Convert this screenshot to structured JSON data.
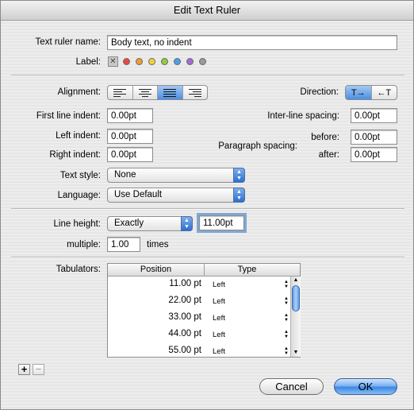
{
  "window": {
    "title": "Edit Text Ruler"
  },
  "ruler_name": {
    "label": "Text ruler name:",
    "value": "Body text, no indent"
  },
  "label_row": {
    "label": "Label:",
    "colors": [
      "#e8493f",
      "#f39a2a",
      "#f0d23a",
      "#8ccf3b",
      "#4f9de6",
      "#a56ad6",
      "#9a9a9a"
    ]
  },
  "alignment": {
    "label": "Alignment:",
    "options": [
      "left",
      "center",
      "justify",
      "right"
    ],
    "selected": "justify"
  },
  "direction": {
    "label": "Direction:",
    "options": [
      "T→",
      "←T"
    ],
    "selected": "T→"
  },
  "indents": {
    "first_line_label": "First line indent:",
    "first_line_value": "0.00pt",
    "left_label": "Left indent:",
    "left_value": "0.00pt",
    "right_label": "Right indent:",
    "right_value": "0.00pt"
  },
  "spacing": {
    "inter_line_label": "Inter-line spacing:",
    "inter_line_value": "0.00pt",
    "paragraph_label": "Paragraph spacing:",
    "before_label": "before:",
    "before_value": "0.00pt",
    "after_label": "after:",
    "after_value": "0.00pt"
  },
  "text_style": {
    "label": "Text style:",
    "value": "None"
  },
  "language": {
    "label": "Language:",
    "value": "Use Default"
  },
  "line_height": {
    "label": "Line height:",
    "mode": "Exactly",
    "value": "11.00pt"
  },
  "multiple": {
    "label": "multiple:",
    "value": "1.00",
    "suffix": "times"
  },
  "tabulators": {
    "label": "Tabulators:",
    "columns": [
      "Position",
      "Type"
    ],
    "rows": [
      {
        "position": "11.00 pt",
        "type": "Left"
      },
      {
        "position": "22.00 pt",
        "type": "Left"
      },
      {
        "position": "33.00 pt",
        "type": "Left"
      },
      {
        "position": "44.00 pt",
        "type": "Left"
      },
      {
        "position": "55.00 pt",
        "type": "Left"
      }
    ]
  },
  "buttons": {
    "add": "+",
    "remove": "−",
    "cancel": "Cancel",
    "ok": "OK"
  }
}
